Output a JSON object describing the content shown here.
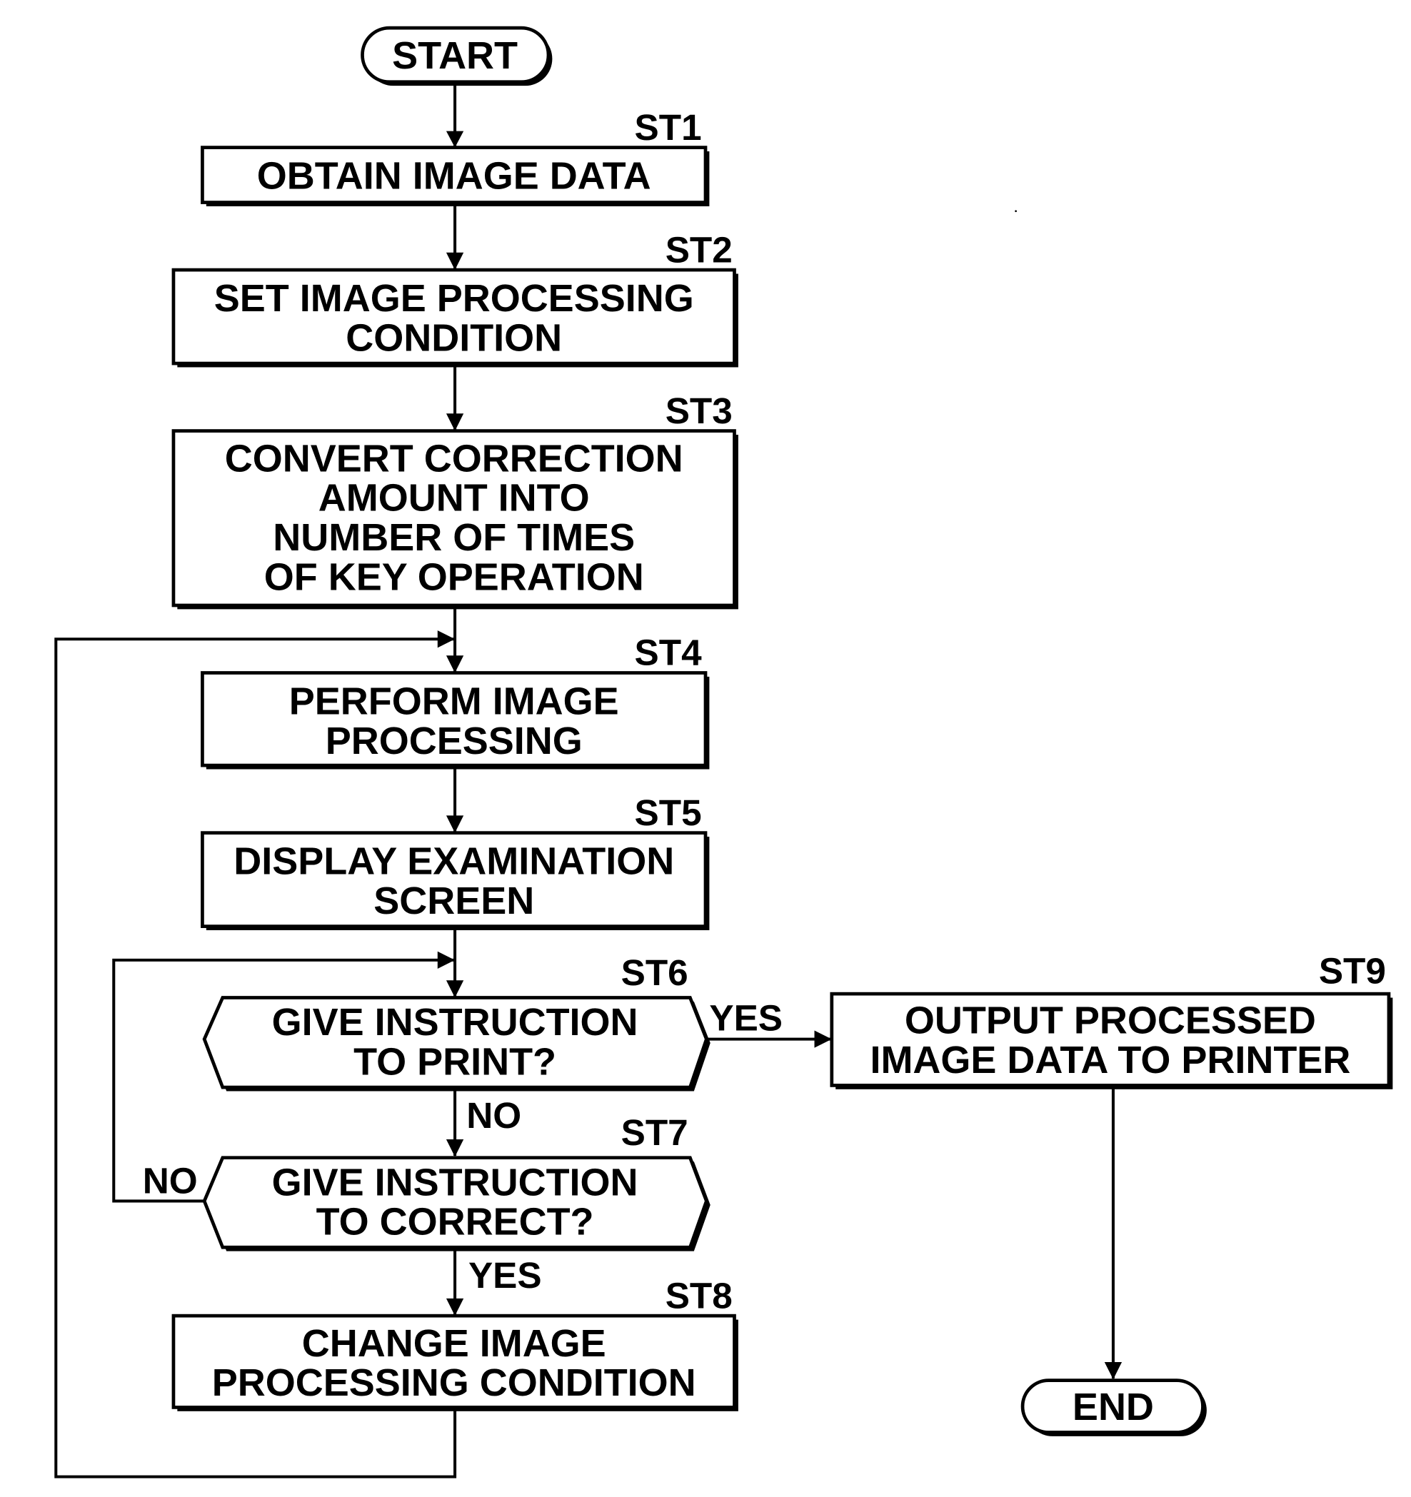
{
  "diagram": {
    "type": "flowchart",
    "colors": {
      "ink": "#000000",
      "background": "#ffffff"
    },
    "terminals": {
      "start": {
        "label": "START"
      },
      "end": {
        "label": "END"
      }
    },
    "steps": [
      {
        "id": "ST1",
        "kind": "process",
        "lines": [
          "OBTAIN IMAGE DATA"
        ]
      },
      {
        "id": "ST2",
        "kind": "process",
        "lines": [
          "SET IMAGE PROCESSING",
          "CONDITION"
        ]
      },
      {
        "id": "ST3",
        "kind": "process",
        "lines": [
          "CONVERT CORRECTION",
          "AMOUNT INTO",
          "NUMBER OF TIMES",
          "OF KEY OPERATION"
        ]
      },
      {
        "id": "ST4",
        "kind": "process",
        "lines": [
          "PERFORM IMAGE",
          "PROCESSING"
        ]
      },
      {
        "id": "ST5",
        "kind": "process",
        "lines": [
          "DISPLAY EXAMINATION",
          "SCREEN"
        ]
      },
      {
        "id": "ST6",
        "kind": "decision",
        "lines": [
          "GIVE INSTRUCTION",
          "TO PRINT?"
        ]
      },
      {
        "id": "ST7",
        "kind": "decision",
        "lines": [
          "GIVE INSTRUCTION",
          "TO CORRECT?"
        ]
      },
      {
        "id": "ST8",
        "kind": "process",
        "lines": [
          "CHANGE IMAGE",
          "PROCESSING CONDITION"
        ]
      },
      {
        "id": "ST9",
        "kind": "process",
        "lines": [
          "OUTPUT PROCESSED",
          "IMAGE DATA TO PRINTER"
        ]
      }
    ],
    "branch_labels": {
      "st6_yes": "YES",
      "st6_no": "NO",
      "st7_no": "NO",
      "st7_yes": "YES"
    },
    "edges": [
      {
        "from": "START",
        "to": "ST1"
      },
      {
        "from": "ST1",
        "to": "ST2"
      },
      {
        "from": "ST2",
        "to": "ST3"
      },
      {
        "from": "ST3",
        "to": "ST4"
      },
      {
        "from": "ST4",
        "to": "ST5"
      },
      {
        "from": "ST5",
        "to": "ST6"
      },
      {
        "from": "ST6",
        "to": "ST9",
        "label": "YES"
      },
      {
        "from": "ST6",
        "to": "ST7",
        "label": "NO"
      },
      {
        "from": "ST7",
        "to": "ST6",
        "label": "NO"
      },
      {
        "from": "ST7",
        "to": "ST8",
        "label": "YES"
      },
      {
        "from": "ST8",
        "to": "ST4"
      },
      {
        "from": "ST9",
        "to": "END"
      }
    ]
  }
}
